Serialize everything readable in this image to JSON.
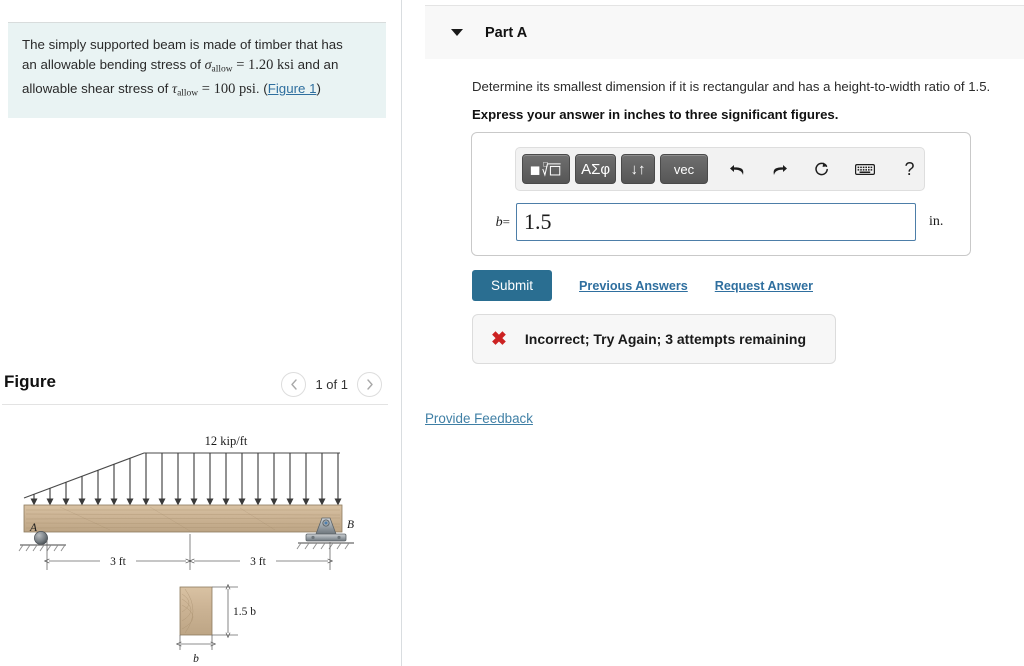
{
  "question": {
    "line1_a": "The simply supported beam is made of timber that has",
    "line2_a": "an allowable bending stress of ",
    "sigma": "σ",
    "sigma_sub": "allow",
    "eq1": " = ",
    "val1": "1.20 ksi",
    "line2_b": " and an",
    "line3_a": "allowable shear stress of ",
    "tau": "τ",
    "tau_sub": "allow",
    "eq2": " = ",
    "val2": "100 psi",
    "line3_b": ". (",
    "figure_link": "Figure 1",
    "line3_c": ")"
  },
  "figure_panel": {
    "title": "Figure",
    "prev_icon": "chevron-left-icon",
    "next_icon": "chevron-right-icon",
    "pager_label": "1 of 1"
  },
  "figure_art": {
    "load_label": "12 kip/ft",
    "support_a_label": "A",
    "support_b_label": "B",
    "dim_left": "3 ft",
    "dim_right": "3 ft",
    "section_height_label": "1.5 b",
    "section_width_label": "b"
  },
  "part": {
    "caret_icon": "chevron-down-icon",
    "title": "Part A",
    "prompt": "Determine its smallest dimension if it is rectangular and has a height-to-width ratio of 1.5.",
    "prompt_bold": "Express your answer in inches to three significant figures."
  },
  "toolbar": {
    "keys": [
      {
        "name": "math-template-key",
        "label": "■ⁿ√☐"
      },
      {
        "name": "greek-symbols-key",
        "label": "ΑΣφ"
      },
      {
        "name": "updown-arrows-key",
        "label": "↓↑"
      },
      {
        "name": "vector-key",
        "label": "vec"
      }
    ],
    "icons": [
      {
        "name": "undo-icon",
        "label": "undo"
      },
      {
        "name": "redo-icon",
        "label": "redo"
      },
      {
        "name": "reset-icon",
        "label": "reset"
      },
      {
        "name": "keyboard-icon",
        "label": "keyboard"
      },
      {
        "name": "help-icon",
        "label": "?"
      }
    ]
  },
  "answer": {
    "variable": "b",
    "equals": "=",
    "value": "1.5",
    "placeholder": "",
    "unit": "in."
  },
  "actions": {
    "submit_label": "Submit",
    "previous_answers_label": "Previous Answers",
    "request_answer_label": "Request Answer"
  },
  "feedback": {
    "icon": "x-mark-icon",
    "icon_glyph": "✖",
    "message": "Incorrect; Try Again; 3 attempts remaining",
    "provide_feedback_label": "Provide Feedback"
  },
  "colors": {
    "question_bg": "#e9f3f3",
    "submit_bg": "#2a6e91",
    "link": "#2f6f9f",
    "error": "#cc2222",
    "input_border": "#4d7ea8",
    "part_header_bg": "#f8f8f8"
  }
}
